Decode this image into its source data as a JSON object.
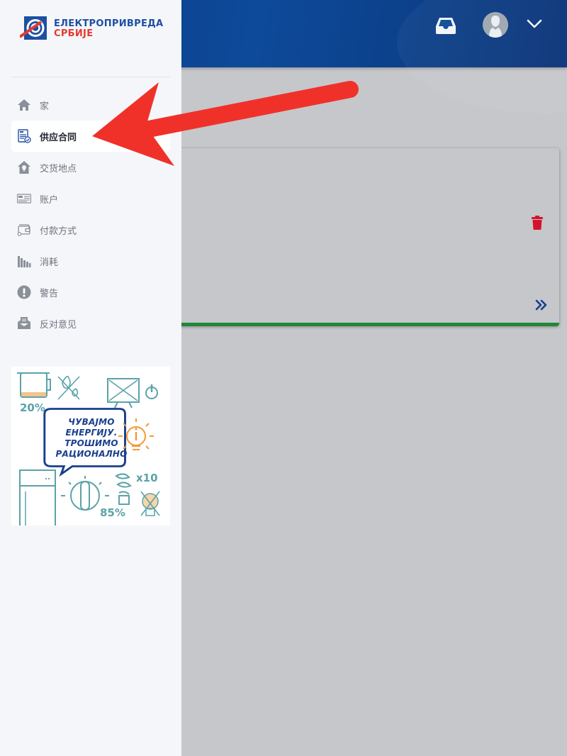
{
  "header": {
    "inbox_icon": "inbox-icon",
    "avatar_icon": "user-avatar-icon",
    "menu_icon": "chevron-down-icon"
  },
  "brand": {
    "name_line1": "ЕЛЕКТРОПРИВРЕДА",
    "name_line2": "СРБИЈЕ",
    "primary_color": "#1d4fa3",
    "accent_color": "#e43a2f"
  },
  "sidebar": {
    "items": [
      {
        "label": "家",
        "icon": "home-icon",
        "active": false
      },
      {
        "label": "供应合同",
        "icon": "contract-icon",
        "active": true
      },
      {
        "label": "交货地点",
        "icon": "delivery-location-icon",
        "active": false
      },
      {
        "label": "账户",
        "icon": "bill-icon",
        "active": false
      },
      {
        "label": "付款方式",
        "icon": "wallet-icon",
        "active": false
      },
      {
        "label": "消耗",
        "icon": "consumption-chart-icon",
        "active": false
      },
      {
        "label": "警告",
        "icon": "warning-icon",
        "active": false
      },
      {
        "label": "反对意见",
        "icon": "complaint-mail-icon",
        "active": false
      }
    ]
  },
  "promo": {
    "line1": "ЧУВАЈМО",
    "line2": "ЕНЕРГИЈУ.",
    "line3": "ТРОШИМО",
    "line4": "РАЦИОНАЛНО",
    "pct_kettle": "20%",
    "pct_bulb": "85%",
    "multiplier": "x10"
  },
  "card": {
    "delete_icon": "trash-icon",
    "more_icon": "double-chevron-right-icon",
    "status_color": "#22863a"
  },
  "annotation": {
    "arrow_color": "#f0312a",
    "target": "供应合同"
  }
}
